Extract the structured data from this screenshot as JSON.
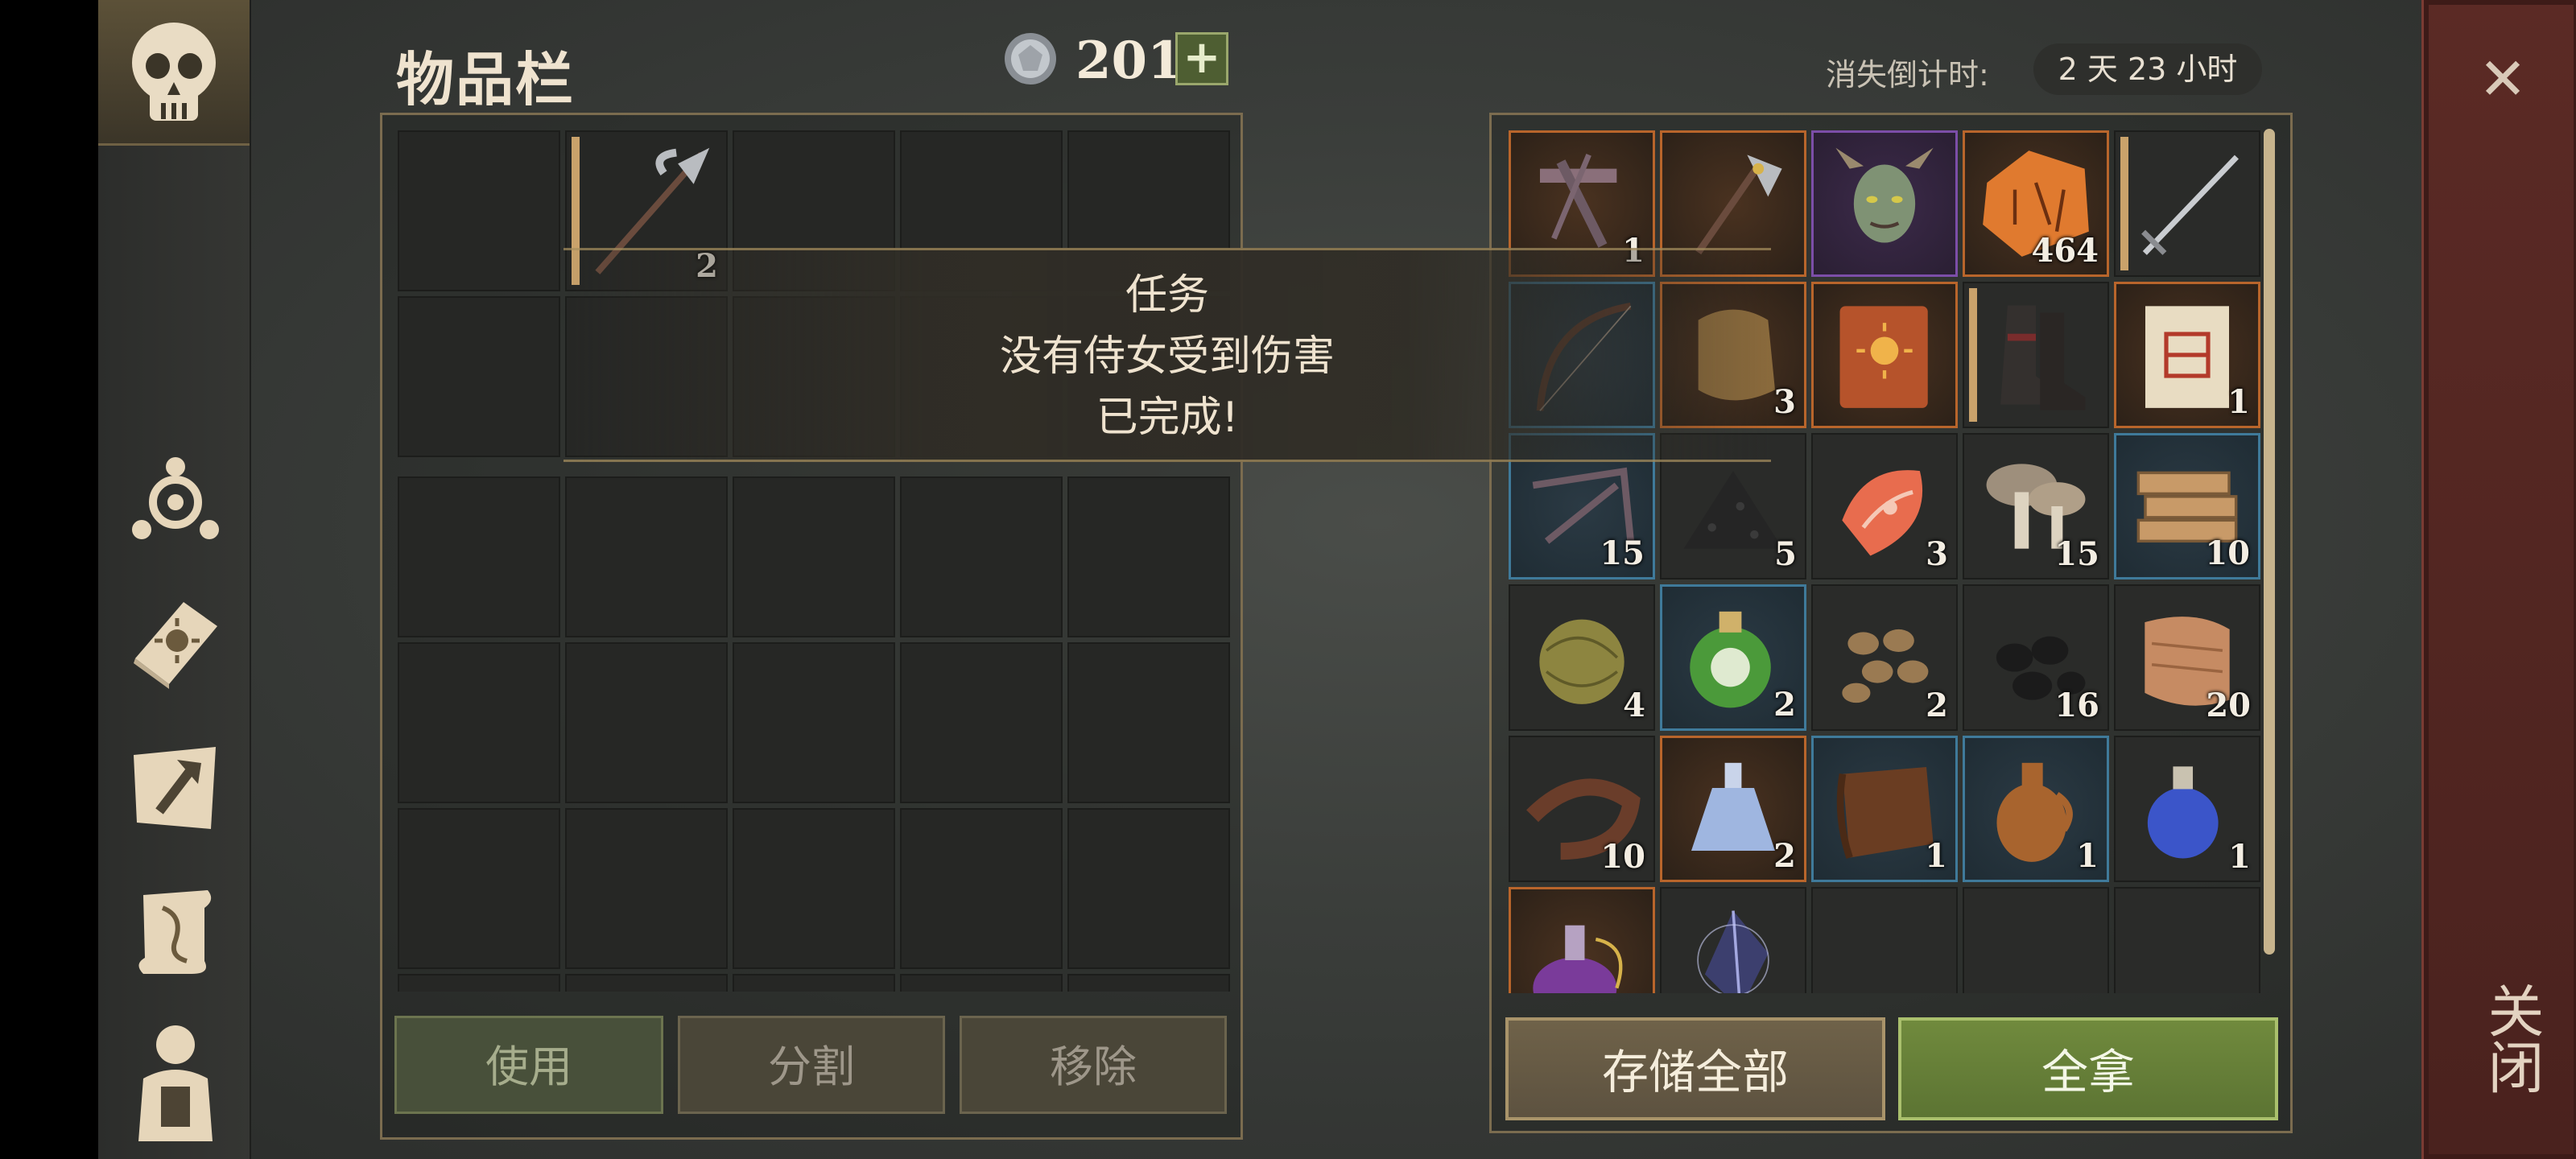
{
  "header": {
    "title": "物品栏",
    "currency_value": "201",
    "currency_plus": "+",
    "timer_label": "消失倒计时:",
    "timer_value": "2 天 23 小时"
  },
  "close": {
    "x_symbol": "✕",
    "label": "关闭"
  },
  "sidebar": {
    "items": [
      {
        "name": "skull-icon"
      },
      {
        "name": "talent-tree-icon"
      },
      {
        "name": "sun-book-icon"
      },
      {
        "name": "map-hammer-icon"
      },
      {
        "name": "quest-scroll-icon"
      },
      {
        "name": "character-icon"
      }
    ]
  },
  "left_inventory": {
    "equipped_weapon_count": "2"
  },
  "right_inventory": {
    "rows": [
      [
        {
          "icon": "crossbow-icon",
          "count": "1",
          "rarity": "orange"
        },
        {
          "icon": "axe-icon",
          "count": "",
          "rarity": "orange"
        },
        {
          "icon": "demon-head-icon",
          "count": "",
          "rarity": "purple"
        },
        {
          "icon": "rune-stone-icon",
          "count": "464",
          "rarity": "orange"
        },
        {
          "icon": "sword-icon",
          "count": "",
          "rarity": "plain"
        }
      ],
      [
        {
          "icon": "bow-icon",
          "count": "",
          "rarity": "blue"
        },
        {
          "icon": "hide-icon",
          "count": "3",
          "rarity": "orange"
        },
        {
          "icon": "sun-book-icon",
          "count": "",
          "rarity": "orange"
        },
        {
          "icon": "boots-icon",
          "count": "",
          "rarity": "plain"
        },
        {
          "icon": "scroll-map-icon",
          "count": "1",
          "rarity": "orange"
        }
      ],
      [
        {
          "icon": "claws-icon",
          "count": "15",
          "rarity": "blue"
        },
        {
          "icon": "coal-pile-icon",
          "count": "5",
          "rarity": "plain"
        },
        {
          "icon": "salmon-icon",
          "count": "3",
          "rarity": "plain"
        },
        {
          "icon": "mushrooms-icon",
          "count": "15",
          "rarity": "plain"
        },
        {
          "icon": "firewood-icon",
          "count": "10",
          "rarity": "blue"
        }
      ],
      [
        {
          "icon": "fiber-ball-icon",
          "count": "4",
          "rarity": "plain"
        },
        {
          "icon": "green-potion-icon",
          "count": "2",
          "rarity": "blue"
        },
        {
          "icon": "nuts-icon",
          "count": "2",
          "rarity": "plain"
        },
        {
          "icon": "black-rocks-icon",
          "count": "16",
          "rarity": "plain"
        },
        {
          "icon": "cloth-icon",
          "count": "20",
          "rarity": "plain"
        }
      ],
      [
        {
          "icon": "leather-strap-icon",
          "count": "10",
          "rarity": "plain"
        },
        {
          "icon": "crystal-flask-icon",
          "count": "2",
          "rarity": "orange"
        },
        {
          "icon": "leather-roll-icon",
          "count": "1",
          "rarity": "blue"
        },
        {
          "icon": "jug-icon",
          "count": "1",
          "rarity": "blue"
        },
        {
          "icon": "blue-potion-icon",
          "count": "1",
          "rarity": "plain"
        }
      ],
      [
        {
          "icon": "purple-potion-icon",
          "count": "",
          "rarity": "orange"
        },
        {
          "icon": "dark-crystal-icon",
          "count": "",
          "rarity": "plain"
        },
        {
          "icon": "",
          "count": "",
          "rarity": "plain"
        },
        {
          "icon": "",
          "count": "",
          "rarity": "plain"
        },
        {
          "icon": "",
          "count": "",
          "rarity": "plain"
        }
      ]
    ]
  },
  "quest_popup": {
    "title": "任务",
    "line1": "没有侍女受到伤害",
    "line2": "已完成!"
  },
  "buttons": {
    "use": "使用",
    "split": "分割",
    "remove": "移除",
    "store_all": "存储全部",
    "take_all": "全拿"
  }
}
